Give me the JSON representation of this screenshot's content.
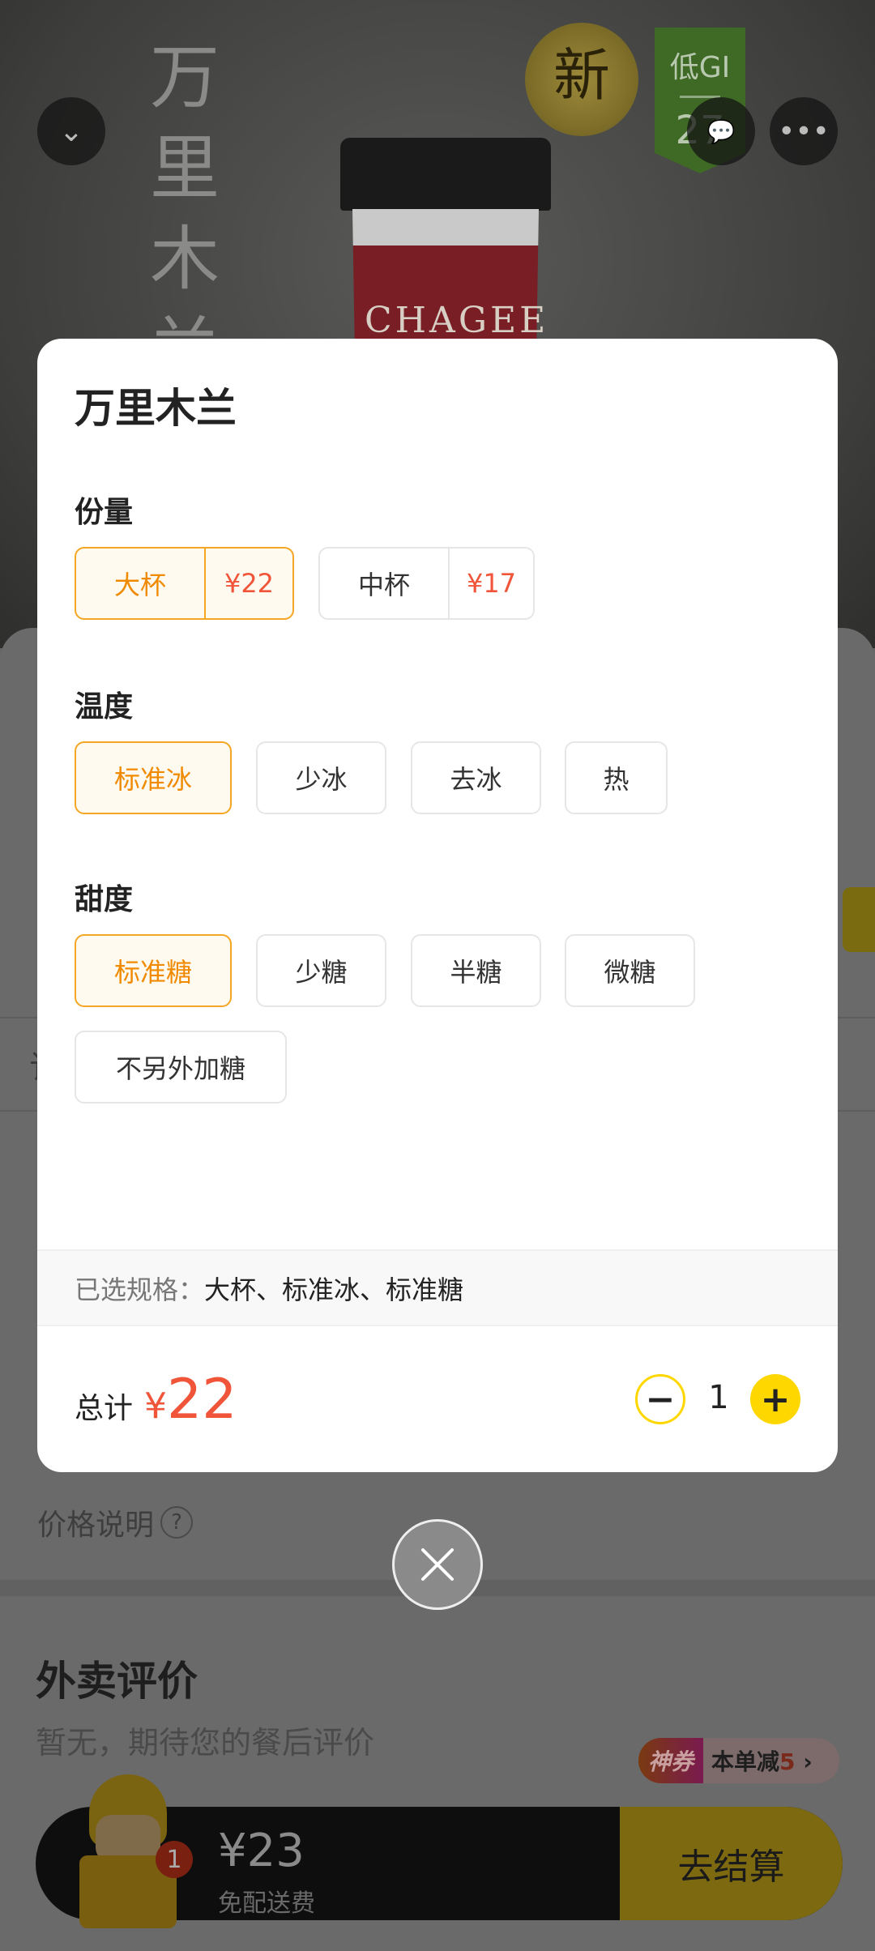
{
  "hero": {
    "vertical_title": "万里木兰",
    "brand_on_cup": "CHAGEE",
    "new_badge": "新",
    "gi_badge": "低GI",
    "gi_value": "27"
  },
  "top_buttons": {
    "back_icon": "chevron-down-icon",
    "service_icon": "chat-icon",
    "more_icon": "more-icon"
  },
  "background_page": {
    "partial_tab": "订",
    "price_note": "价格说明",
    "help_icon": "?",
    "reviews_title": "外卖评价",
    "reviews_empty": "暂无，期待您的餐后评价",
    "coupon_tag": "神券",
    "coupon_text": "本单减",
    "coupon_amount": "5",
    "cart_count": "1",
    "cart_price": "¥23",
    "cart_delivery": "免配送费",
    "checkout_label": "去结算"
  },
  "modal": {
    "title": "万里木兰",
    "sections": [
      {
        "label": "份量",
        "options": [
          {
            "label": "大杯",
            "price": "¥22",
            "selected": true
          },
          {
            "label": "中杯",
            "price": "¥17",
            "selected": false
          }
        ]
      },
      {
        "label": "温度",
        "options": [
          {
            "label": "标准冰",
            "selected": true
          },
          {
            "label": "少冰"
          },
          {
            "label": "去冰"
          },
          {
            "label": "热"
          }
        ]
      },
      {
        "label": "甜度",
        "options": [
          {
            "label": "标准糖",
            "selected": true
          },
          {
            "label": "少糖"
          },
          {
            "label": "半糖"
          },
          {
            "label": "微糖"
          },
          {
            "label": "不另外加糖"
          }
        ]
      }
    ],
    "selected_label": "已选规格：",
    "selected_value": "大杯、标准冰、标准糖",
    "total_label": "总计",
    "total_currency": "¥",
    "total_value": "22",
    "quantity": "1",
    "minus": "−",
    "plus": "+"
  },
  "colors": {
    "accent": "#f5a623",
    "price": "#f0553a",
    "yellow": "#ffd700"
  }
}
